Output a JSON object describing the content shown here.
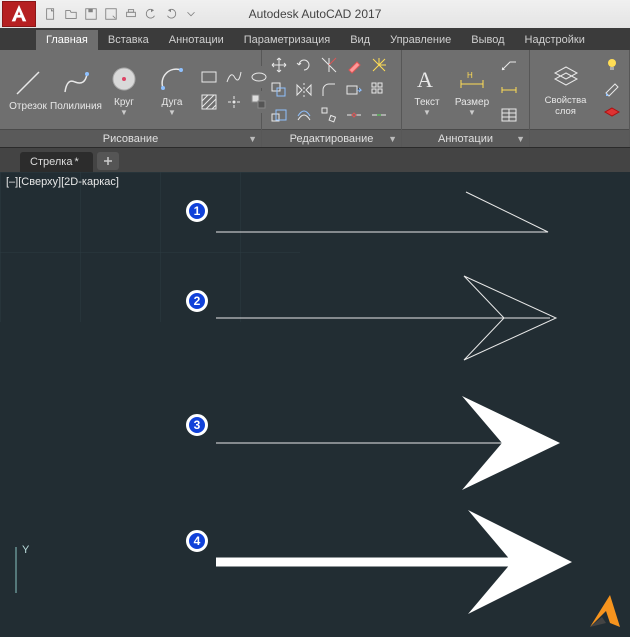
{
  "app": {
    "title": "Autodesk AutoCAD 2017"
  },
  "ribbonTabs": [
    "Главная",
    "Вставка",
    "Аннотации",
    "Параметризация",
    "Вид",
    "Управление",
    "Вывод",
    "Надстройки"
  ],
  "activeTab": "Главная",
  "panels": {
    "draw": {
      "name": "Рисование",
      "tools": {
        "line": "Отрезок",
        "polyline": "Полилиния",
        "circle": "Круг",
        "arc": "Дуга"
      }
    },
    "modify": {
      "name": "Редактирование"
    },
    "annot": {
      "name": "Аннотации",
      "tools": {
        "text": "Текст",
        "dimension": "Размер"
      }
    },
    "layerprops": {
      "name": "Свойства слоя"
    }
  },
  "docTab": {
    "name": "Стрелка",
    "dirty": "*"
  },
  "viewLabel": "[–][Сверху][2D-каркас]",
  "ucsLabel": "Y",
  "markers": [
    "1",
    "2",
    "3",
    "4"
  ]
}
